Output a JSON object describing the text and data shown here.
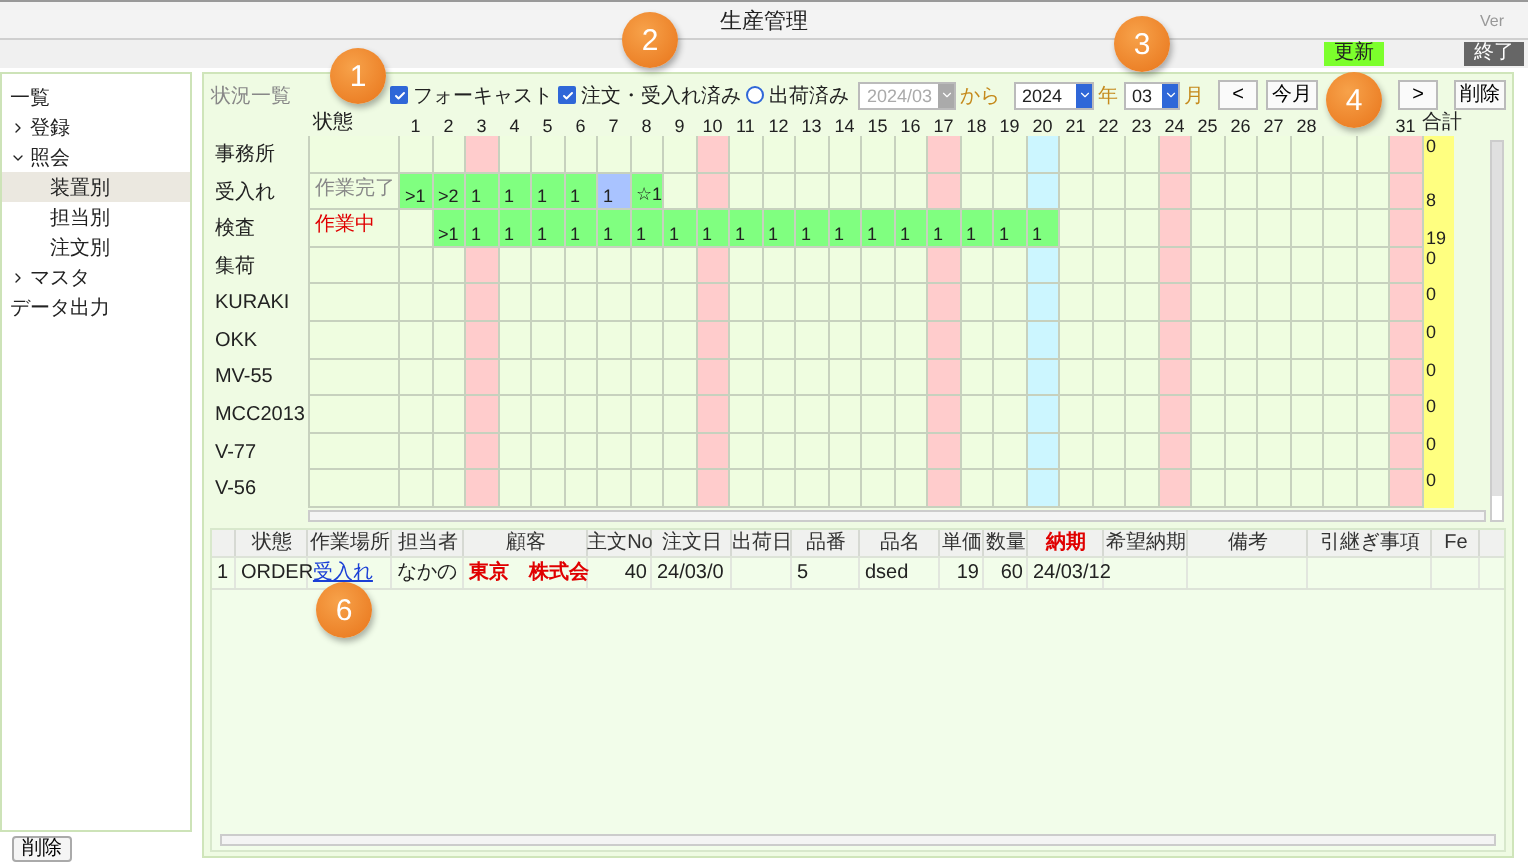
{
  "window": {
    "title": "生産管理",
    "version": "Ver"
  },
  "toolbar": {
    "buttons": [
      {
        "label": "更新",
        "kind": "update"
      },
      {
        "label": "終了",
        "kind": "exit"
      }
    ]
  },
  "sidebar": {
    "items": [
      {
        "label": "一覧",
        "selected": false
      },
      {
        "label": "登録",
        "selected": false,
        "expanded": false
      },
      {
        "label": "照会",
        "selected": false,
        "expanded": true,
        "children": [
          {
            "label": "装置別",
            "selected": true
          },
          {
            "label": "担当別",
            "selected": false
          },
          {
            "label": "注文別",
            "selected": false
          }
        ]
      },
      {
        "label": "マスタ",
        "selected": false,
        "expanded": false
      },
      {
        "label": "データ出力",
        "selected": false
      }
    ],
    "footer_button": "削除"
  },
  "status_panel": {
    "title": "状況一覧",
    "filters": [
      {
        "kind": "checkbox",
        "label": "フォーキャスト",
        "checked": true
      },
      {
        "kind": "checkbox",
        "label": "注文・受入れ済み",
        "checked": true
      },
      {
        "kind": "radio",
        "label": "出荷済み",
        "checked": false
      }
    ],
    "from_field": {
      "value": "2024/03",
      "disabled": true
    },
    "from_label": "から",
    "year": {
      "value": "2024"
    },
    "year_label": "年",
    "month": {
      "value": "03"
    },
    "month_label": "月",
    "nav_buttons": [
      "<",
      "今月",
      ">"
    ],
    "delete_button": "削除"
  },
  "schedule": {
    "status_header": "状態",
    "total_header": "合計",
    "days": [
      {
        "label": "1",
        "kind": "weekday"
      },
      {
        "label": "2",
        "kind": "weekday"
      },
      {
        "label": "3",
        "kind": "sunday"
      },
      {
        "label": "4",
        "kind": "weekday"
      },
      {
        "label": "5",
        "kind": "weekday"
      },
      {
        "label": "6",
        "kind": "weekday"
      },
      {
        "label": "7",
        "kind": "weekday"
      },
      {
        "label": "8",
        "kind": "weekday"
      },
      {
        "label": "9",
        "kind": "weekday"
      },
      {
        "label": "10",
        "kind": "sunday"
      },
      {
        "label": "11",
        "kind": "weekday"
      },
      {
        "label": "12",
        "kind": "weekday"
      },
      {
        "label": "13",
        "kind": "weekday"
      },
      {
        "label": "14",
        "kind": "weekday"
      },
      {
        "label": "15",
        "kind": "weekday"
      },
      {
        "label": "16",
        "kind": "weekday"
      },
      {
        "label": "17",
        "kind": "sunday"
      },
      {
        "label": "18",
        "kind": "weekday"
      },
      {
        "label": "19",
        "kind": "weekday"
      },
      {
        "label": "20",
        "kind": "holiday"
      },
      {
        "label": "21",
        "kind": "weekday"
      },
      {
        "label": "22",
        "kind": "weekday"
      },
      {
        "label": "23",
        "kind": "weekday"
      },
      {
        "label": "24",
        "kind": "sunday"
      },
      {
        "label": "25",
        "kind": "weekday"
      },
      {
        "label": "26",
        "kind": "weekday"
      },
      {
        "label": "27",
        "kind": "weekday"
      },
      {
        "label": "28",
        "kind": "weekday"
      },
      {
        "kind": "weekday"
      },
      {
        "kind": "weekday"
      },
      {
        "label": "31",
        "kind": "sunday"
      }
    ],
    "rows": [
      {
        "label": "事務所",
        "total": "0"
      },
      {
        "label": "受入れ",
        "status": "作業完了",
        "in_progress": false,
        "total": "8",
        "cells": [
          {
            "kind": "work",
            "text": ">1"
          },
          {
            "kind": "work",
            "text": ">2"
          },
          {
            "kind": "work",
            "text": "1"
          },
          {
            "kind": "work",
            "text": "1"
          },
          {
            "kind": "work",
            "text": "1"
          },
          {
            "kind": "work",
            "text": "1"
          },
          {
            "kind": "selected",
            "text": "1"
          },
          {
            "kind": "work",
            "text": "☆1"
          },
          {
            "kind": "empty"
          },
          {
            "kind": "empty"
          },
          {
            "kind": "empty"
          },
          {
            "kind": "empty"
          },
          {
            "kind": "empty"
          },
          {
            "kind": "empty"
          },
          {
            "kind": "empty"
          },
          {
            "kind": "empty"
          },
          {
            "kind": "empty"
          },
          {
            "kind": "empty"
          },
          {
            "kind": "empty"
          },
          {
            "kind": "empty"
          },
          {
            "kind": "empty"
          },
          {
            "kind": "empty"
          },
          {
            "kind": "empty"
          },
          {
            "kind": "empty"
          },
          {
            "kind": "empty"
          },
          {
            "kind": "empty"
          },
          {
            "kind": "empty"
          },
          {
            "kind": "empty"
          },
          {
            "kind": "empty"
          },
          {
            "kind": "empty"
          },
          {
            "kind": "empty"
          }
        ]
      },
      {
        "label": "検査",
        "status": "作業中",
        "in_progress": true,
        "total": "19",
        "cells": [
          {
            "kind": "empty"
          },
          {
            "kind": "work",
            "text": ">1"
          },
          {
            "kind": "work",
            "text": "1"
          },
          {
            "kind": "work",
            "text": "1"
          },
          {
            "kind": "work",
            "text": "1"
          },
          {
            "kind": "work",
            "text": "1"
          },
          {
            "kind": "work",
            "text": "1"
          },
          {
            "kind": "work",
            "text": "1"
          },
          {
            "kind": "work",
            "text": "1"
          },
          {
            "kind": "work",
            "text": "1"
          },
          {
            "kind": "work",
            "text": "1"
          },
          {
            "kind": "work",
            "text": "1"
          },
          {
            "kind": "work",
            "text": "1"
          },
          {
            "kind": "work",
            "text": "1"
          },
          {
            "kind": "work",
            "text": "1"
          },
          {
            "kind": "work",
            "text": "1"
          },
          {
            "kind": "work",
            "text": "1"
          },
          {
            "kind": "work",
            "text": "1"
          },
          {
            "kind": "work",
            "text": "1"
          },
          {
            "kind": "work",
            "text": "1"
          },
          {
            "kind": "empty"
          },
          {
            "kind": "empty"
          },
          {
            "kind": "empty"
          },
          {
            "kind": "empty"
          },
          {
            "kind": "empty"
          },
          {
            "kind": "empty"
          },
          {
            "kind": "empty"
          },
          {
            "kind": "empty"
          },
          {
            "kind": "empty"
          },
          {
            "kind": "empty"
          },
          {
            "kind": "empty"
          }
        ]
      },
      {
        "label": "集荷",
        "total": "0"
      },
      {
        "label": "KURAKI",
        "total": "0"
      },
      {
        "label": "OKK",
        "total": "0"
      },
      {
        "label": "MV-55",
        "total": "0"
      },
      {
        "label": "MCC2013",
        "total": "0"
      },
      {
        "label": "V-77",
        "total": "0"
      },
      {
        "label": "V-56",
        "total": "0"
      }
    ]
  },
  "orders": {
    "columns": [
      {
        "label": "状態",
        "emphasis": false
      },
      {
        "label": "作業場所",
        "emphasis": false
      },
      {
        "label": "担当者",
        "emphasis": false
      },
      {
        "label": "顧客",
        "emphasis": false
      },
      {
        "label": "主文No",
        "emphasis": false
      },
      {
        "label": "注文日",
        "emphasis": false
      },
      {
        "label": "出荷日",
        "emphasis": false
      },
      {
        "label": "品番",
        "emphasis": false
      },
      {
        "label": "品名",
        "emphasis": false
      },
      {
        "label": "単価",
        "emphasis": false
      },
      {
        "label": "数量",
        "emphasis": false
      },
      {
        "label": "納期",
        "emphasis": true
      },
      {
        "label": "希望納期",
        "emphasis": false
      },
      {
        "label": "備考",
        "emphasis": false
      },
      {
        "label": "引継ぎ事項",
        "emphasis": false
      },
      {
        "label": "Fe",
        "emphasis": false
      }
    ],
    "rows": [
      {
        "index": "1",
        "cells": [
          {
            "kind": "text",
            "text": "ORDER"
          },
          {
            "kind": "link",
            "text": "受入れ"
          },
          {
            "kind": "text",
            "text": "なかの"
          },
          {
            "kind": "alert",
            "text": "東京　株式会"
          },
          {
            "kind": "number",
            "text": "40"
          },
          {
            "kind": "text",
            "text": "24/03/0"
          },
          {
            "kind": "empty"
          },
          {
            "kind": "text",
            "text": "5"
          },
          {
            "kind": "text",
            "text": "dsed"
          },
          {
            "kind": "number",
            "text": "19"
          },
          {
            "kind": "number",
            "text": "60"
          },
          {
            "kind": "text",
            "text": "24/03/12"
          },
          {
            "kind": "empty"
          },
          {
            "kind": "empty"
          },
          {
            "kind": "empty"
          },
          {
            "kind": "empty"
          }
        ]
      }
    ]
  },
  "callouts": [
    {
      "label": "1"
    },
    {
      "label": "2"
    },
    {
      "label": "3"
    },
    {
      "label": "4"
    },
    {
      "label": "6"
    }
  ]
}
